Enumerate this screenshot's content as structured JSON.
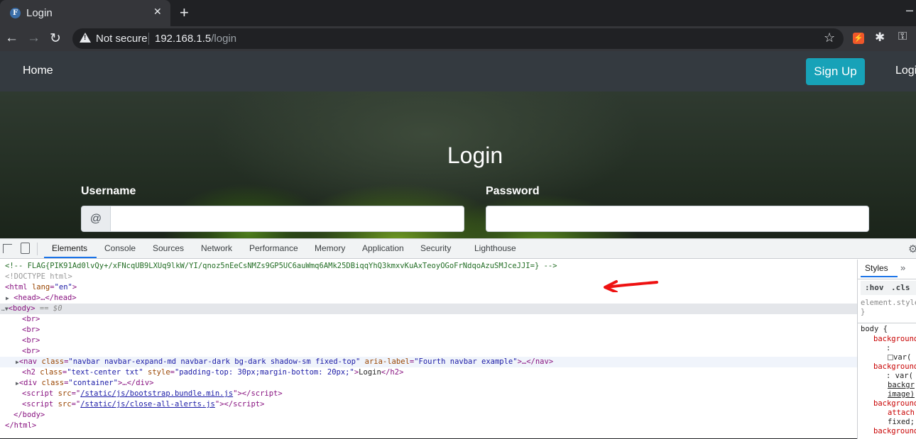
{
  "browser": {
    "tab_title": "Login",
    "favicon_letter": "F",
    "tab_close": "✕",
    "new_tab": "+",
    "minimize": "–",
    "security_label": "Not secure",
    "url_host": "192.168.1.5",
    "url_path": "/login"
  },
  "navbar": {
    "home": "Home",
    "signup": "Sign Up",
    "login": "Login"
  },
  "form": {
    "title": "Login",
    "username_label": "Username",
    "password_label": "Password",
    "username_prefix": "@",
    "username_value": "",
    "password_value": ""
  },
  "devtools": {
    "tabs": [
      "Elements",
      "Console",
      "Sources",
      "Network",
      "Performance",
      "Memory",
      "Application",
      "Security",
      "Lighthouse"
    ],
    "active_tab": "Elements",
    "dom": {
      "comment": "<!-- FLAG{PIK91Ad0lvQy+/xFNcqUB9LXUq9lkW/YI/qnoz5nEeCsNMZs9GP5UC6auWmq6AMk25DBiqqYhQ3kmxvKuAxTeoyOGoFrNdqoAzuSMJceJJI=} -->",
      "doctype": "<!DOCTYPE html>",
      "html_open": "<html",
      "html_lang_attr": "lang",
      "html_lang_val": "\"en\"",
      "head": "<head>…</head>",
      "body_open": "<body>",
      "body_selected": "== $0",
      "br": "<br>",
      "nav_class": "\"navbar navbar-expand-md navbar-dark bg-dark shadow-sm fixed-top\"",
      "nav_aria": "\"Fourth navbar example\"",
      "h2_class": "\"text-center txt\"",
      "h2_style": "\"padding-top: 30px;margin-bottom: 20px;\"",
      "h2_text": "Login",
      "div_class": "\"container\"",
      "script1_src": "/static/js/bootstrap.bundle.min.js",
      "script2_src": "/static/js/close-all-alerts.js",
      "body_close": "</body>",
      "html_close": "</html>"
    },
    "styles": {
      "tab": "Styles",
      "hov": ":hov",
      "cls": ".cls",
      "element_style": "element.style {",
      "close_brace": "}",
      "body_rule": "body {",
      "lines": [
        "background",
        ":",
        "var(",
        "background",
        ": var(",
        "backgr",
        "image)",
        "background",
        "attach",
        "fixed;",
        "background"
      ]
    }
  },
  "colors": {
    "navbar_bg": "#343a40",
    "signup_bg": "#17a2b8",
    "devtools_accent": "#1a73e8",
    "annotation_arrow": "#ee1111"
  }
}
